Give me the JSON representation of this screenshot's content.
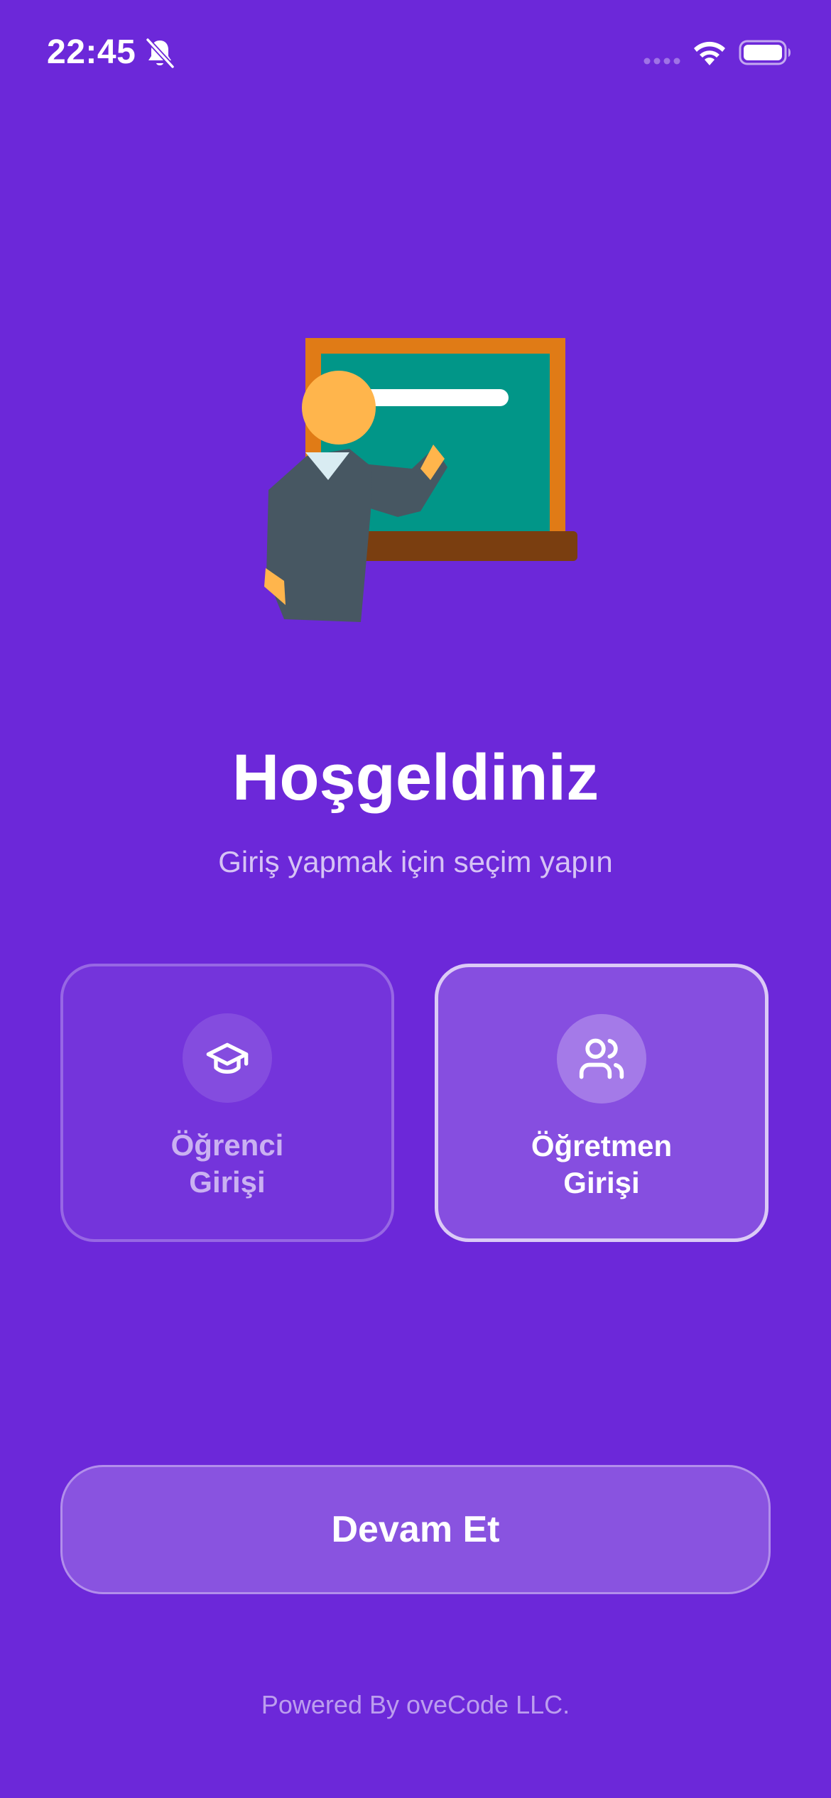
{
  "status_bar": {
    "time": "22:45",
    "icons": [
      "bell-slash-icon",
      "cellular-signal-icon",
      "wifi-icon",
      "battery-icon"
    ]
  },
  "illustration": {
    "name": "teacher-at-blackboard-illustration"
  },
  "welcome": {
    "title": "Hoşgeldiniz",
    "subtitle": "Giriş yapmak için seçim yapın"
  },
  "roles": [
    {
      "label_line1": "Öğrenci",
      "label_line2": "Girişi",
      "icon": "graduation-cap-icon",
      "selected": false
    },
    {
      "label_line1": "Öğretmen",
      "label_line2": "Girişi",
      "icon": "users-icon",
      "selected": true
    }
  ],
  "continue_button": {
    "label": "Devam Et"
  },
  "footer": {
    "text": "Powered By oveCode LLC."
  },
  "colors": {
    "background": "#6c28d9",
    "text": "#ffffff",
    "blackboard": "#019688",
    "board_frame": "#e07b16",
    "board_ledge": "#7a3e10",
    "teacher_suit": "#475762",
    "skin": "#ffb54c"
  }
}
